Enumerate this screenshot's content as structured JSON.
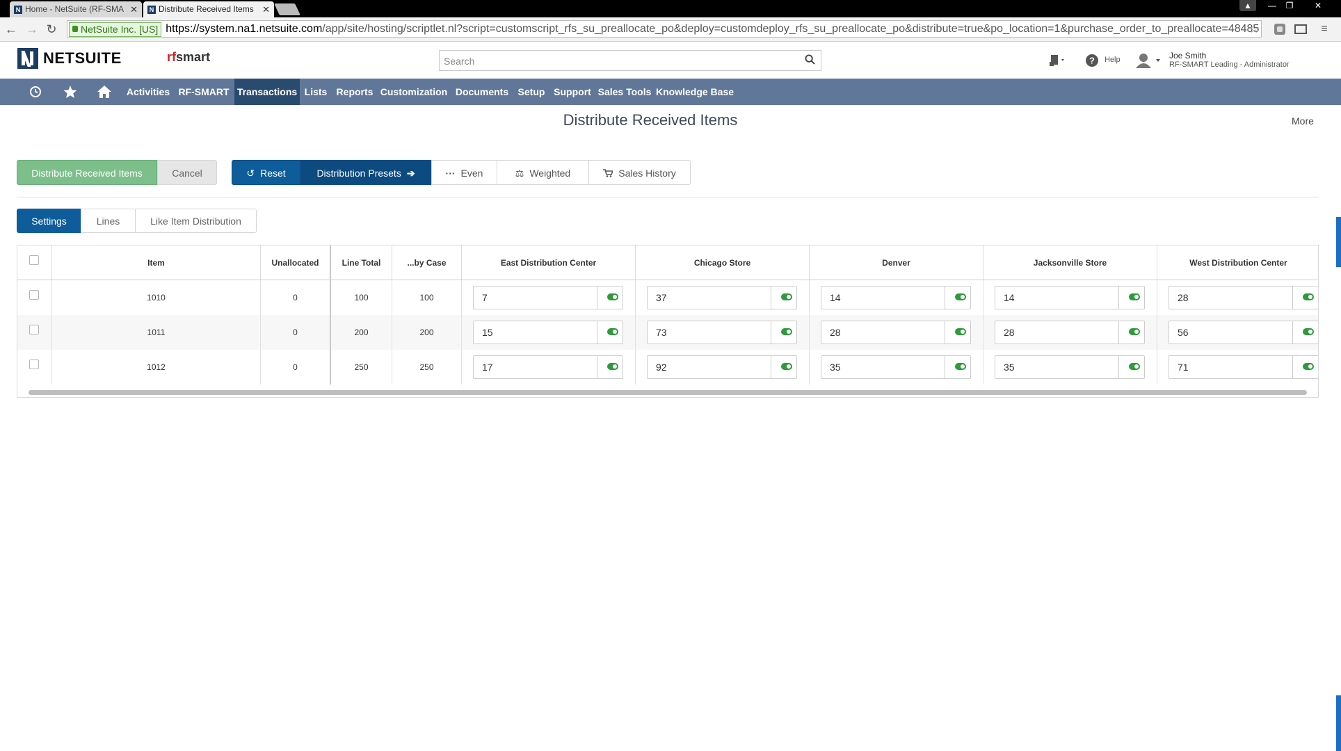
{
  "browser": {
    "tabs": [
      {
        "label": "Home - NetSuite (RF-SMA",
        "active": false
      },
      {
        "label": "Distribute Received Items",
        "active": true
      }
    ],
    "secure_label": "NetSuite Inc. [US]",
    "url_host": "https://system.na1.netsuite.com",
    "url_path": "/app/site/hosting/scriptlet.nl?script=customscript_rfs_su_preallocate_po&deploy=customdeploy_rfs_su_preallocate_po&distribute=true&po_location=1&purchase_order_to_preallocate=48485"
  },
  "header": {
    "logo_text": "NETSUITE",
    "brand_rf": "rf",
    "brand_smart": "smart",
    "search_placeholder": "Search",
    "help_label": "Help",
    "user_name": "Joe Smith",
    "user_role": "RF-SMART Leading - Administrator"
  },
  "nav": {
    "items": [
      "Activities",
      "RF-SMART",
      "Transactions",
      "Lists",
      "Reports",
      "Customization",
      "Documents",
      "Setup",
      "Support",
      "Sales Tools",
      "Knowledge Base"
    ],
    "active": "Transactions"
  },
  "page": {
    "title": "Distribute Received Items",
    "more": "More"
  },
  "actions": {
    "distribute": "Distribute Received Items",
    "cancel": "Cancel",
    "reset": "Reset",
    "presets": "Distribution Presets",
    "even": "Even",
    "weighted": "Weighted",
    "sales_history": "Sales History"
  },
  "subtabs": [
    "Settings",
    "Lines",
    "Like Item Distribution"
  ],
  "grid": {
    "columns": {
      "item": "Item",
      "unallocated": "Unallocated",
      "line_total": "Line Total",
      "by_case": "...by Case",
      "locations": [
        "East Distribution Center",
        "Chicago Store",
        "Denver",
        "Jacksonville Store",
        "West Distribution Center"
      ]
    },
    "rows": [
      {
        "item": "1010",
        "unallocated": "0",
        "line_total": "100",
        "by_case": "100",
        "qty": [
          "7",
          "37",
          "14",
          "14",
          "28"
        ]
      },
      {
        "item": "1011",
        "unallocated": "0",
        "line_total": "200",
        "by_case": "200",
        "qty": [
          "15",
          "73",
          "28",
          "28",
          "56"
        ]
      },
      {
        "item": "1012",
        "unallocated": "0",
        "line_total": "250",
        "by_case": "250",
        "qty": [
          "17",
          "92",
          "35",
          "35",
          "71"
        ]
      }
    ]
  },
  "colors": {
    "nav_bg": "#607799",
    "nav_active": "#2a4b70",
    "primary_blue": "#0f5c9b",
    "green_button": "#7dbf8a",
    "toggle_on": "#2e9a3c"
  }
}
